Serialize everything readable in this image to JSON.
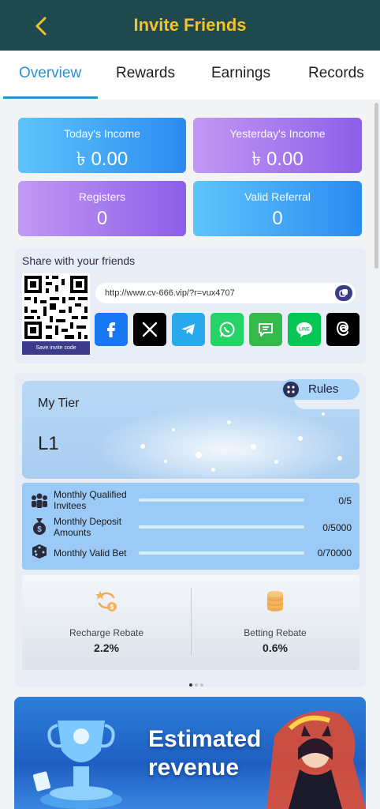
{
  "header": {
    "title": "Invite Friends"
  },
  "tabs": [
    {
      "label": "Overview",
      "active": true
    },
    {
      "label": "Rewards",
      "active": false
    },
    {
      "label": "Earnings",
      "active": false
    },
    {
      "label": "Records",
      "active": false
    }
  ],
  "stats": {
    "today": {
      "label": "Today's Income",
      "value": "৳ 0.00"
    },
    "yesterday": {
      "label": "Yesterday's Income",
      "value": "৳ 0.00"
    },
    "registers": {
      "label": "Registers",
      "value": "0"
    },
    "valid_referral": {
      "label": "Valid Referral",
      "value": "0"
    }
  },
  "share": {
    "title": "Share with your friends",
    "save_code": "Save invite code",
    "link": "http://www.cv-666.vip/?r=vux4707",
    "socials": [
      {
        "icon": "facebook-icon",
        "color": "#1877f2"
      },
      {
        "icon": "x-icon",
        "color": "#000000"
      },
      {
        "icon": "telegram-icon",
        "color": "#29a9eb"
      },
      {
        "icon": "whatsapp-icon",
        "color": "#25d366"
      },
      {
        "icon": "sms-icon",
        "color": "#35b94a"
      },
      {
        "icon": "line-icon",
        "color": "#06c755",
        "text": "LINE"
      },
      {
        "icon": "threads-icon",
        "color": "#000000"
      }
    ]
  },
  "tier": {
    "title": "My Tier",
    "level": "L1",
    "rules_label": "Rules",
    "requirements": [
      {
        "label": "Monthly Qualified Invitees",
        "value": "0/5",
        "progress": 0,
        "icon": "users-icon"
      },
      {
        "label": "Monthly Deposit Amounts",
        "value": "0/5000",
        "progress": 0,
        "icon": "money-bag-icon"
      },
      {
        "label": "Monthly Valid Bet",
        "value": "0/70000",
        "progress": 0,
        "icon": "dice-icon"
      }
    ],
    "rebates": [
      {
        "label": "Recharge Rebate",
        "value": "2.2%",
        "icon": "recharge-icon"
      },
      {
        "label": "Betting Rebate",
        "value": "0.6%",
        "icon": "coin-stack-icon"
      }
    ]
  },
  "promo": {
    "text_line1": "Estimated",
    "text_line2": "revenue"
  },
  "colors": {
    "header_bg": "#1e4a4e",
    "title": "#f3c22a",
    "accent": "#2f8fd0"
  }
}
